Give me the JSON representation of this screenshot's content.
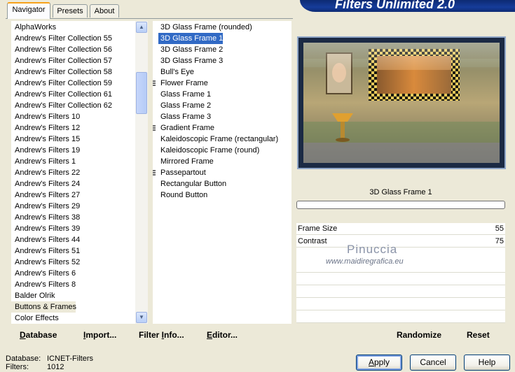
{
  "banner": {
    "title": "Filters Unlimited 2.0"
  },
  "tabs": [
    {
      "label": "Navigator",
      "active": true
    },
    {
      "label": "Presets",
      "active": false
    },
    {
      "label": "About",
      "active": false
    }
  ],
  "categories": [
    "AlphaWorks",
    "Andrew's Filter Collection 55",
    "Andrew's Filter Collection 56",
    "Andrew's Filter Collection 57",
    "Andrew's Filter Collection 58",
    "Andrew's Filter Collection 59",
    "Andrew's Filter Collection 61",
    "Andrew's Filter Collection 62",
    "Andrew's Filters 10",
    "Andrew's Filters 12",
    "Andrew's Filters 15",
    "Andrew's Filters 19",
    "Andrew's Filters 1",
    "Andrew's Filters 22",
    "Andrew's Filters 24",
    "Andrew's Filters 27",
    "Andrew's Filters 29",
    "Andrew's Filters 38",
    "Andrew's Filters 39",
    "Andrew's Filters 44",
    "Andrew's Filters 51",
    "Andrew's Filters 52",
    "Andrew's Filters 6",
    "Andrew's Filters 8",
    "Balder Olrik",
    "Buttons & Frames",
    "Color Effects"
  ],
  "selected_category_index": 25,
  "filters": [
    {
      "label": "3D Glass Frame (rounded)",
      "multi": false
    },
    {
      "label": "3D Glass Frame 1",
      "multi": false
    },
    {
      "label": "3D Glass Frame 2",
      "multi": false
    },
    {
      "label": "3D Glass Frame 3",
      "multi": false
    },
    {
      "label": "Bull's Eye",
      "multi": false
    },
    {
      "label": "Flower Frame",
      "multi": true
    },
    {
      "label": "Glass Frame 1",
      "multi": false
    },
    {
      "label": "Glass Frame 2",
      "multi": false
    },
    {
      "label": "Glass Frame 3",
      "multi": false
    },
    {
      "label": "Gradient Frame",
      "multi": true
    },
    {
      "label": "Kaleidoscopic Frame (rectangular)",
      "multi": false
    },
    {
      "label": "Kaleidoscopic Frame (round)",
      "multi": false
    },
    {
      "label": "Mirrored Frame",
      "multi": false
    },
    {
      "label": "Passepartout",
      "multi": true
    },
    {
      "label": "Rectangular Button",
      "multi": false
    },
    {
      "label": "Round Button",
      "multi": false
    }
  ],
  "selected_filter_index": 1,
  "preview": {
    "filter_name": "3D Glass Frame 1",
    "progress": 0
  },
  "params": [
    {
      "label": "Frame Size",
      "value": "55"
    },
    {
      "label": "Contrast",
      "value": "75"
    }
  ],
  "watermark": {
    "name": "Pinuccia",
    "url": "www.maidiregrafica.eu"
  },
  "toolbar": {
    "database": {
      "pre": "",
      "u": "D",
      "post": "atabase"
    },
    "import": {
      "pre": "",
      "u": "I",
      "post": "mport..."
    },
    "filter_info": {
      "pre": "Filter ",
      "u": "I",
      "post": "nfo..."
    },
    "editor": {
      "pre": "",
      "u": "E",
      "post": "ditor..."
    },
    "randomize": "Randomize",
    "reset": "Reset"
  },
  "status": {
    "database_label": "Database:",
    "database_value": "ICNET-Filters",
    "filters_label": "Filters:",
    "filters_value": "1012"
  },
  "buttons": {
    "apply": {
      "pre": "",
      "u": "A",
      "post": "pply"
    },
    "cancel": "Cancel",
    "help": "Help"
  },
  "colors": {
    "selection": "#316ac5",
    "banner": "#163c9a",
    "dialog_bg": "#ece9d8"
  }
}
